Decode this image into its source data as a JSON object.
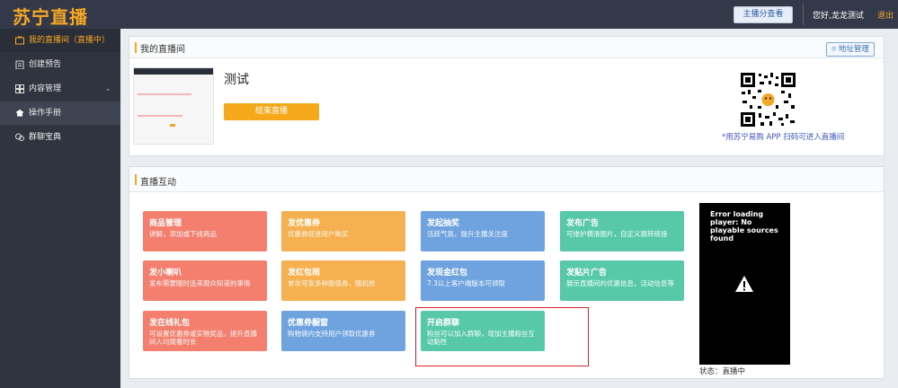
{
  "header": {
    "logo": "苏宁直播",
    "host_button": "主播分查看",
    "greeting": "您好,龙龙测试",
    "logout": "退出"
  },
  "sidebar": {
    "items": [
      {
        "label": "我的直播间（直播中）",
        "icon": "live-tv-icon"
      },
      {
        "label": "创建预告",
        "icon": "clipboard-icon"
      },
      {
        "label": "内容管理",
        "icon": "grid-icon"
      },
      {
        "label": "操作手册",
        "icon": "book-icon"
      },
      {
        "label": "群聊宝典",
        "icon": "chat-icon"
      }
    ]
  },
  "room": {
    "title": "我的直播间",
    "address_button": "地址管理",
    "stream_title": "测试",
    "end_button": "结束直播",
    "qr_caption": "*用苏宁易购 APP 扫码可进入直播间"
  },
  "interaction": {
    "title": "直播互动",
    "tiles": [
      {
        "title": "商品管理",
        "desc": "讲解，添加或下线商品"
      },
      {
        "title": "发优惠券",
        "desc": "优惠券促进用户购买"
      },
      {
        "title": "发起抽奖",
        "desc": "活跃气氛，提升主播关注度"
      },
      {
        "title": "发布广告",
        "desc": "可维护横滑图片，自定义跳转链接"
      },
      {
        "title": "发小喇叭",
        "desc": "发布需要随时追来观众知道的事情"
      },
      {
        "title": "发红包雨",
        "desc": "单次可发多种面值券，随机抢"
      },
      {
        "title": "发现金红包",
        "desc": "7.3以上客户端版本可领取"
      },
      {
        "title": "发贴片广告",
        "desc": "展示直播间的优惠信息，活动信息等"
      },
      {
        "title": "发在线礼包",
        "desc": "可设置优惠券或实物奖品，提升直播间人均观看时长"
      },
      {
        "title": "优惠券橱窗",
        "desc": "购物袋内支持用户领取优惠券"
      },
      {
        "title": "开启群聊",
        "desc": "粉丝可以加入群聊，增加主播粉丝互动黏性"
      }
    ]
  },
  "player": {
    "error": "Error loading player: No playable sources found",
    "status": "状态：直播中"
  }
}
